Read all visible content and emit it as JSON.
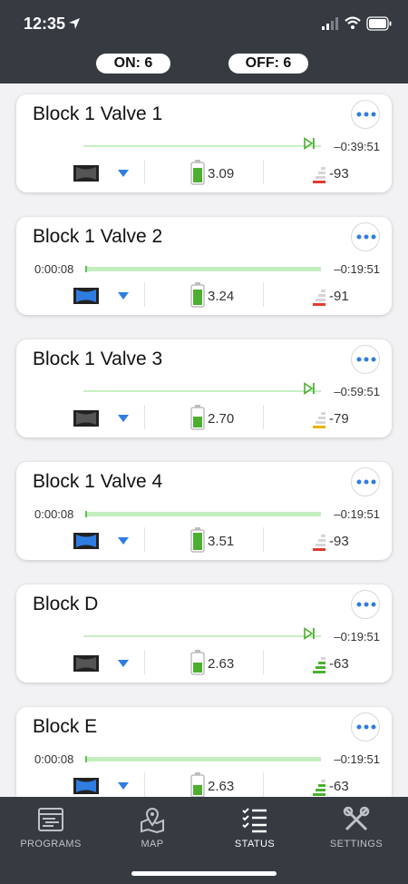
{
  "status_bar": {
    "time": "12:35"
  },
  "summary": {
    "on_label": "ON: 6",
    "off_label": "OFF: 6"
  },
  "valves": [
    {
      "name": "Block 1 Valve 1",
      "running": false,
      "elapsed": "",
      "remaining": "–0:39:51",
      "valve_state": "closed",
      "voltage": "3.09",
      "battery_level": 0.8,
      "rssi": "-93",
      "signal_bars": 0,
      "signal_color": "#e23b2e"
    },
    {
      "name": "Block 1 Valve 2",
      "running": true,
      "elapsed": "0:00:08",
      "remaining": "–0:19:51",
      "valve_state": "open",
      "voltage": "3.24",
      "battery_level": 0.85,
      "rssi": "-91",
      "signal_bars": 0,
      "signal_color": "#e23b2e"
    },
    {
      "name": "Block 1 Valve 3",
      "running": false,
      "elapsed": "",
      "remaining": "–0:59:51",
      "valve_state": "closed",
      "voltage": "2.70",
      "battery_level": 0.6,
      "rssi": "-79",
      "signal_bars": 1,
      "signal_color": "#e8b400"
    },
    {
      "name": "Block 1 Valve 4",
      "running": true,
      "elapsed": "0:00:08",
      "remaining": "–0:19:51",
      "valve_state": "open",
      "voltage": "3.51",
      "battery_level": 0.95,
      "rssi": "-93",
      "signal_bars": 0,
      "signal_color": "#e23b2e"
    },
    {
      "name": "Block D",
      "running": false,
      "elapsed": "",
      "remaining": "–0:19:51",
      "valve_state": "closed",
      "voltage": "2.63",
      "battery_level": 0.55,
      "rssi": "-63",
      "signal_bars": 3,
      "signal_color": "#4caf2f"
    },
    {
      "name": "Block E",
      "running": true,
      "elapsed": "0:00:08",
      "remaining": "–0:19:51",
      "valve_state": "open",
      "voltage": "2.63",
      "battery_level": 0.55,
      "rssi": "-63",
      "signal_bars": 3,
      "signal_color": "#4caf2f"
    }
  ],
  "tabs": [
    {
      "label": "PROGRAMS",
      "icon": "programs-icon",
      "active": false
    },
    {
      "label": "MAP",
      "icon": "map-icon",
      "active": false
    },
    {
      "label": "STATUS",
      "icon": "status-list-icon",
      "active": true
    },
    {
      "label": "SETTINGS",
      "icon": "settings-tools-icon",
      "active": false
    }
  ],
  "colors": {
    "header": "#363b42",
    "accent_blue": "#2f7de1",
    "progress_green": "#5cc24f",
    "valve_closed": "#555555",
    "valve_open": "#2f7de1"
  }
}
